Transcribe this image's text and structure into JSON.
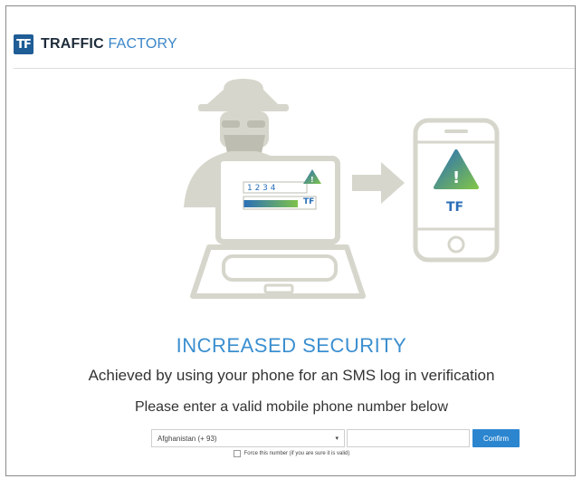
{
  "header": {
    "logo_text": "TF",
    "brand_part1": "TRAFFIC",
    "brand_part2": "FACTORY"
  },
  "illustration": {
    "laptop_screen_digits": "1 2 3 4",
    "phone_logo": "TF",
    "laptop_logo": "TF",
    "phone_alert": "!",
    "laptop_alert": "!"
  },
  "content": {
    "title": "INCREASED SECURITY",
    "subtitle": "Achieved by using your phone for an SMS log in verification",
    "instruction": "Please enter a valid mobile phone number below"
  },
  "form": {
    "country_selected": "Afghanistan (+ 93)",
    "phone_value": "",
    "confirm_label": "Confirm",
    "force_label": "Force this number (if you are sure it is valid)"
  },
  "colors": {
    "brand_blue": "#1f5d96",
    "accent_blue": "#3b8fd0",
    "illustration_grey": "#d6d6cc",
    "gradient_start": "#2a6fb8",
    "gradient_end": "#7fc24a"
  }
}
